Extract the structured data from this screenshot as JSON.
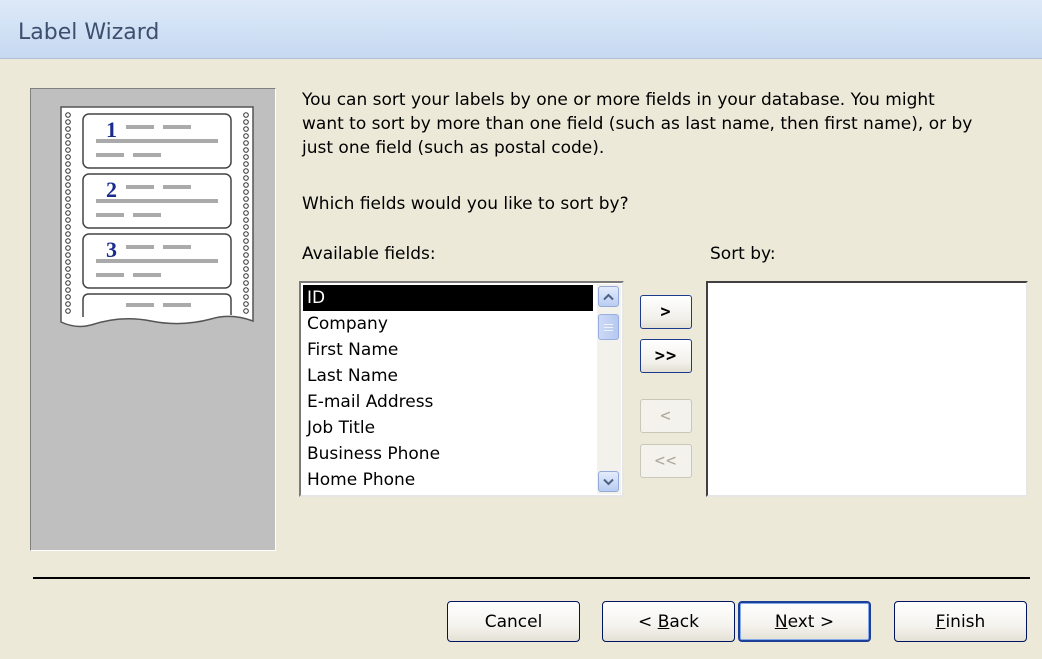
{
  "window": {
    "title": "Label Wizard"
  },
  "illustration": {
    "labels": [
      "1",
      "2",
      "3"
    ]
  },
  "intro_text": "You can sort your labels by one or more fields in your database.  You might\nwant to sort by more than one field (such as last name, then first name), or by\njust one field (such as postal code).",
  "question": "Which fields would you like to sort by?",
  "available": {
    "label": "Available fields:",
    "items": [
      "ID",
      "Company",
      "First Name",
      "Last Name",
      "E-mail Address",
      "Job Title",
      "Business Phone",
      "Home Phone"
    ],
    "selected_index": 0
  },
  "sort_by": {
    "label": "Sort by:",
    "items": []
  },
  "move_buttons": {
    "add_one": ">",
    "add_all": ">>",
    "remove_one": "<",
    "remove_all": "<<"
  },
  "buttons": {
    "cancel": "Cancel",
    "back_prefix": "< ",
    "back_mnemonic": "B",
    "back_rest": "ack",
    "next_mnemonic": "N",
    "next_rest": "ext >",
    "finish_mnemonic": "F",
    "finish_rest": "inish"
  },
  "colors": {
    "title_text": "#3b4f6e",
    "dialog_bg": "#ece9d8",
    "selection_bg": "#000000",
    "button_border": "#00135e"
  }
}
